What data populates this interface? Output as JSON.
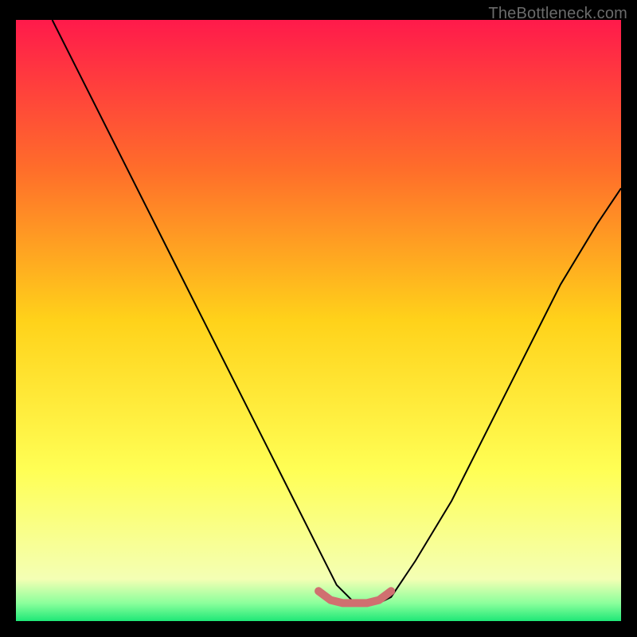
{
  "watermark": "TheBottleneck.com",
  "chart_data": {
    "type": "line",
    "title": "",
    "xlabel": "",
    "ylabel": "",
    "xlim": [
      0,
      100
    ],
    "ylim": [
      0,
      100
    ],
    "background_gradient": {
      "stops": [
        {
          "offset": 0.0,
          "color": "#ff1a4b"
        },
        {
          "offset": 0.25,
          "color": "#ff6e2a"
        },
        {
          "offset": 0.5,
          "color": "#ffd21a"
        },
        {
          "offset": 0.75,
          "color": "#ffff55"
        },
        {
          "offset": 0.93,
          "color": "#f4ffb4"
        },
        {
          "offset": 0.97,
          "color": "#8cff9c"
        },
        {
          "offset": 1.0,
          "color": "#1fe877"
        }
      ]
    },
    "series": [
      {
        "name": "bottleneck-curve",
        "type": "line",
        "x": [
          6,
          10,
          14,
          18,
          22,
          26,
          30,
          34,
          38,
          42,
          46,
          50,
          53,
          56,
          60,
          62,
          66,
          72,
          78,
          84,
          90,
          96,
          100
        ],
        "y": [
          100,
          92,
          84,
          76,
          68,
          60,
          52,
          44,
          36,
          28,
          20,
          12,
          6,
          3,
          3,
          4,
          10,
          20,
          32,
          44,
          56,
          66,
          72
        ],
        "color": "#000000"
      },
      {
        "name": "optimal-band",
        "type": "line",
        "x": [
          50,
          52,
          54,
          56,
          58,
          60,
          62
        ],
        "y": [
          5,
          3.5,
          3,
          3,
          3,
          3.5,
          5
        ],
        "color": "#d07070"
      }
    ],
    "optimal_range_x": [
      50,
      62
    ]
  }
}
